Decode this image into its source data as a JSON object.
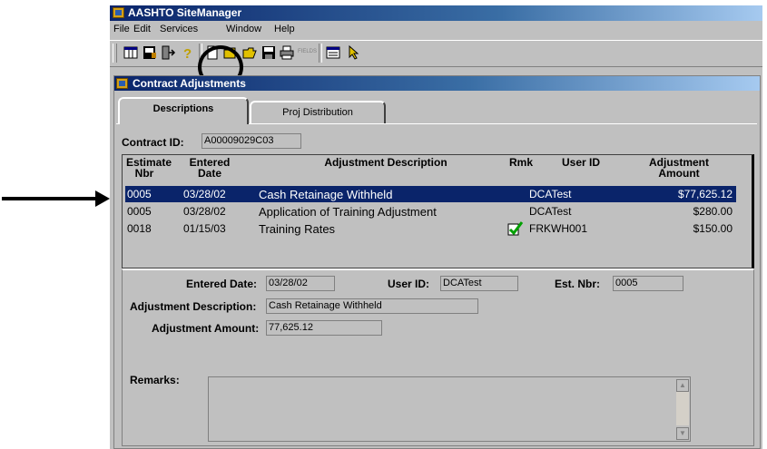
{
  "app": {
    "title": "AASHTO SiteManager",
    "menu": [
      "File",
      "Edit",
      "Services",
      "Window",
      "Help"
    ],
    "toolbar_icons": [
      "grid-view-icon",
      "save-window-icon",
      "exit-icon",
      "help-icon",
      "new-document-icon",
      "open-folder-icon",
      "open-icon",
      "save-icon",
      "print-icon",
      "fields-icon",
      "list-icon",
      "pointer-icon"
    ],
    "toolbar_fields_label": "FIELDS"
  },
  "child": {
    "title": "Contract Adjustments",
    "tabs": [
      {
        "label": "Descriptions",
        "active": true
      },
      {
        "label": "Proj Distribution",
        "active": false
      }
    ]
  },
  "contract": {
    "label": "Contract ID:",
    "value": "A00009029C03"
  },
  "grid": {
    "headers": {
      "estimate": [
        "Estimate",
        "Nbr"
      ],
      "entered": [
        "Entered",
        "Date"
      ],
      "description": "Adjustment Description",
      "rmk": "Rmk",
      "user": "User ID",
      "amount": [
        "Adjustment",
        "Amount"
      ]
    },
    "rows": [
      {
        "est": "0005",
        "date": "03/28/02",
        "desc": "Cash Retainage Withheld",
        "rmk": false,
        "user": "DCATest",
        "amount": "$77,625.12",
        "selected": true
      },
      {
        "est": "0005",
        "date": "03/28/02",
        "desc": "Application of Training Adjustment",
        "rmk": false,
        "user": "DCATest",
        "amount": "$280.00",
        "selected": false
      },
      {
        "est": "0018",
        "date": "01/15/03",
        "desc": "Training Rates",
        "rmk": true,
        "user": "FRKWH001",
        "amount": "$150.00",
        "selected": false
      }
    ]
  },
  "detail": {
    "entered_date_label": "Entered Date:",
    "entered_date": "03/28/02",
    "user_id_label": "User ID:",
    "user_id": "DCATest",
    "est_nbr_label": "Est. Nbr:",
    "est_nbr": "0005",
    "desc_label": "Adjustment Description:",
    "desc": "Cash Retainage Withheld",
    "amount_label": "Adjustment Amount:",
    "amount": "77,625.12",
    "remarks_label": "Remarks:",
    "remarks": ""
  },
  "colors": {
    "selection": "#0a246a",
    "title_gradient_start": "#0a246a",
    "face": "#c0c0c0"
  }
}
